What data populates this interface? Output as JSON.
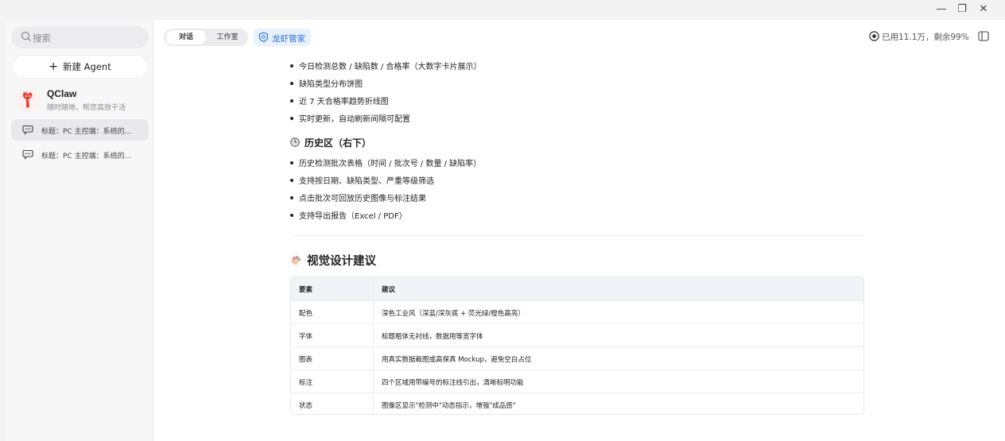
{
  "window": {
    "minimize_label": "—",
    "maximize_label": "❐",
    "close_label": "✕"
  },
  "sidebar": {
    "search_placeholder": "搜索",
    "new_agent_label": "新建 Agent",
    "agent": {
      "name": "QClaw",
      "description": "随时随地，帮您高效干活"
    },
    "sessions": [
      {
        "title": "标题：PC 主控端：系统的…"
      },
      {
        "title": "标题：PC 主控端：系统的…"
      }
    ]
  },
  "header": {
    "tabs": [
      {
        "label": "对话"
      },
      {
        "label": "工作室"
      }
    ],
    "butler_label": "龙虾管家",
    "usage_text": "已用11.1万，剩余99%"
  },
  "content": {
    "bullets_top": [
      "今日检测总数 / 缺陷数 / 合格率（大数字卡片展示）",
      "缺陷类型分布饼图",
      "近 7 天合格率趋势折线图",
      "实时更新，自动刷新间隔可配置"
    ],
    "history_heading": "历史区（右下）",
    "bullets_history": [
      "历史检测批次表格（时间 / 批次号 / 数量 / 缺陷率）",
      "支持按日期、缺陷类型、严重等级筛选",
      "点击批次可回放历史图像与标注结果",
      "支持导出报告（Excel / PDF）"
    ],
    "design_heading": "视觉设计建议",
    "table": {
      "headers": [
        "要素",
        "建议"
      ],
      "rows": [
        [
          "配色",
          "深色工业风（深蓝/深灰底 + 荧光绿/橙色高亮）"
        ],
        [
          "字体",
          "标题粗体无衬线，数据用等宽字体"
        ],
        [
          "图表",
          "用真实数据截图或高保真 Mockup，避免空白占位"
        ],
        [
          "标注",
          "四个区域用带编号的标注线引出，清晰标明功能"
        ],
        [
          "状态",
          "图像区显示\"检测中\"动态指示，增强\"成品感\""
        ]
      ]
    }
  },
  "colors": {
    "accent": "#2f6fdb",
    "avatar": "#e8403a"
  }
}
